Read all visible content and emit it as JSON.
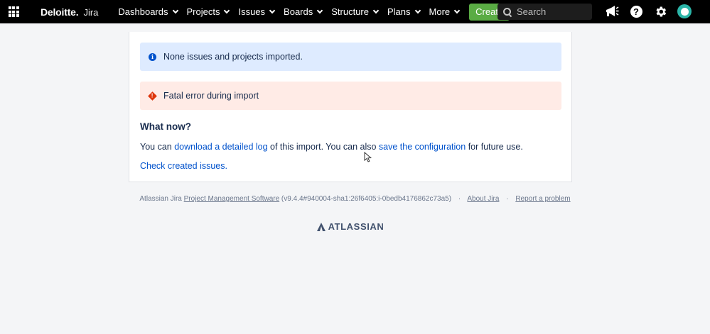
{
  "nav": {
    "brand": "Deloitte.",
    "product": "Jira",
    "items": [
      {
        "label": "Dashboards"
      },
      {
        "label": "Projects"
      },
      {
        "label": "Issues"
      },
      {
        "label": "Boards"
      },
      {
        "label": "Structure"
      },
      {
        "label": "Plans"
      },
      {
        "label": "More"
      }
    ],
    "create_label": "Create",
    "search_placeholder": "Search",
    "icons": [
      "app-switcher-icon",
      "megaphone-icon",
      "help-icon",
      "gear-icon",
      "avatar"
    ]
  },
  "messages": {
    "info": "None issues and projects imported.",
    "error": "Fatal error during import"
  },
  "content": {
    "heading": "What now?",
    "text_1": "You can ",
    "link_log": "download a detailed log",
    "text_2": " of this import. You can also ",
    "link_config": "save the configuration",
    "text_3": " for future use.",
    "check_link": "Check created issues."
  },
  "footer": {
    "prefix": "Atlassian Jira ",
    "pms_link": "Project Management Software",
    "version": " (v9.4.4#940004-sha1:26f6405:i-0bedb4176862c73a5)",
    "about_link": "About Jira",
    "report_link": "Report a problem",
    "logo_text": "ATLASSIAN"
  },
  "colors": {
    "nav_bg": "#000000",
    "create_bg": "#5aac44",
    "info_bg": "#deebff",
    "error_bg": "#ffebe6",
    "link": "#0052cc"
  }
}
